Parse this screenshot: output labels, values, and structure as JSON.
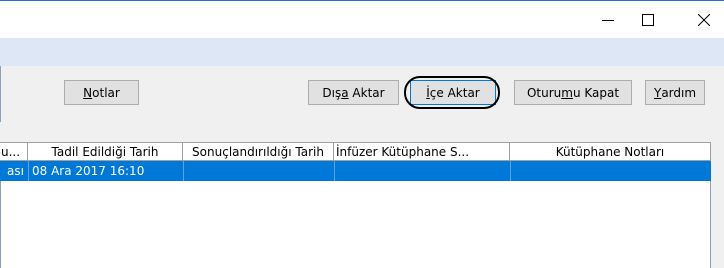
{
  "window": {
    "minimize_glyph": "–",
    "maximize_glyph": "☐",
    "close_glyph": "✕"
  },
  "toolbar": {
    "notes": {
      "prefix": "",
      "accel": "N",
      "suffix": "otlar"
    },
    "export": {
      "prefix": "Dış",
      "accel": "a",
      "suffix": " Aktar"
    },
    "import": {
      "prefix": "",
      "accel": "İ",
      "suffix": "çe Aktar"
    },
    "logout": {
      "prefix": "Oturu",
      "accel": "m",
      "suffix": "u Kapat"
    },
    "help": {
      "prefix": "",
      "accel": "Y",
      "suffix": "ardım"
    }
  },
  "grid": {
    "columns": [
      "u...",
      "Tadil Edildiği Tarih",
      "Sonuçlandırıldığı Tarih",
      "İnfüzer Kütüphane S...",
      "Kütüphane Notları"
    ],
    "rows": [
      {
        "c0": "ası",
        "c1": "08 Ara 2017 16:10",
        "c2": "",
        "c3": "",
        "c4": ""
      }
    ]
  },
  "colors": {
    "selection": "#0078d7",
    "band": "#dde7f5",
    "toolbar_bg": "#f0f0f0",
    "button_bg": "#e1e1e1"
  }
}
